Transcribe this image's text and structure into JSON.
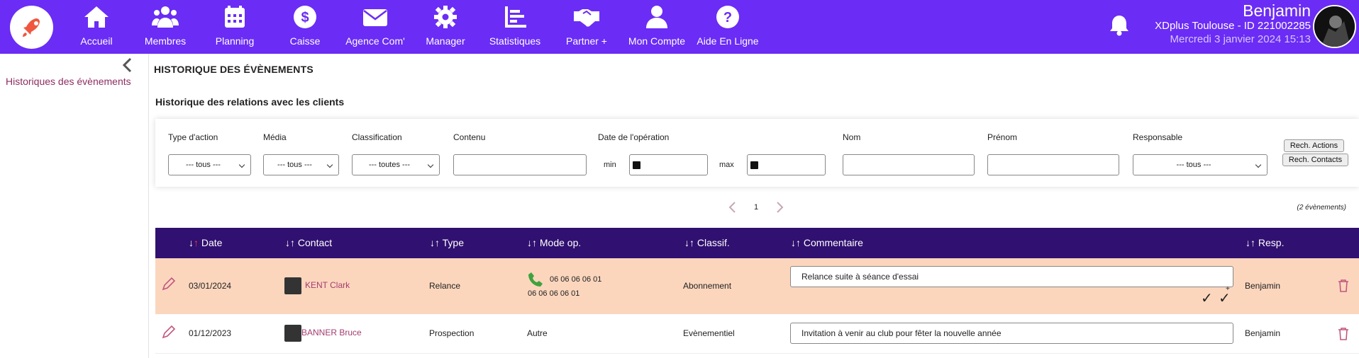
{
  "nav": [
    {
      "label": "Accueil",
      "icon": "home-icon"
    },
    {
      "label": "Membres",
      "icon": "members-icon"
    },
    {
      "label": "Planning",
      "icon": "calendar-icon"
    },
    {
      "label": "Caisse",
      "icon": "dollar-icon"
    },
    {
      "label": "Agence Com'",
      "icon": "mail-icon"
    },
    {
      "label": "Manager",
      "icon": "gear-icon"
    },
    {
      "label": "Statistiques",
      "icon": "stats-icon"
    },
    {
      "label": "Partner +",
      "icon": "handshake-icon"
    },
    {
      "label": "Mon Compte",
      "icon": "user-icon"
    },
    {
      "label": "Aide En Ligne",
      "icon": "help-icon"
    }
  ],
  "user": {
    "name": "Benjamin",
    "club": "XDplus Toulouse - ID 221002285",
    "date": "Mercredi 3 janvier 2024 15:13"
  },
  "sidebar": {
    "item": "Historiques des évènements"
  },
  "page": {
    "title": "HISTORIQUE DES ÉVÈNEMENTS",
    "section": "Historique des relations avec les clients"
  },
  "filters": {
    "type_label": "Type d'action",
    "type_value": "--- tous ---",
    "media_label": "Média",
    "media_value": "--- tous ---",
    "class_label": "Classification",
    "class_value": "--- toutes ---",
    "content_label": "Contenu",
    "date_label": "Date de l'opération",
    "min": "min",
    "max": "max",
    "name_label": "Nom",
    "first_label": "Prénom",
    "resp_label": "Responsable",
    "resp_value": "--- tous ---",
    "btn_actions": "Rech. Actions",
    "btn_contacts": "Rech. Contacts"
  },
  "pagination": {
    "page": "1",
    "count": "(2 évènements)"
  },
  "table": {
    "headers": [
      "Date",
      "Contact",
      "Type",
      "Mode op.",
      "Classif.",
      "Commentaire",
      "Resp."
    ],
    "rows": [
      {
        "date": "03/01/2024",
        "contact": "KENT Clark",
        "type": "Relance",
        "mode1": "06 06 06 06 01",
        "mode2": "06 06 06 06 01",
        "classif": "Abonnement",
        "comment": "Relance suite à séance d'essai",
        "resp": "Benjamin"
      },
      {
        "date": "01/12/2023",
        "contact": "BANNER Bruce",
        "type": "Prospection",
        "mode1": "Autre",
        "classif": "Evènementiel",
        "comment": "Invitation à venir au club pour fêter la nouvelle année",
        "resp": "Benjamin"
      }
    ]
  },
  "colors": {
    "topbar": "#6b2cf5",
    "header": "#301070",
    "row_highlight": "#fbd6bd",
    "accent": "#a43c6f"
  }
}
